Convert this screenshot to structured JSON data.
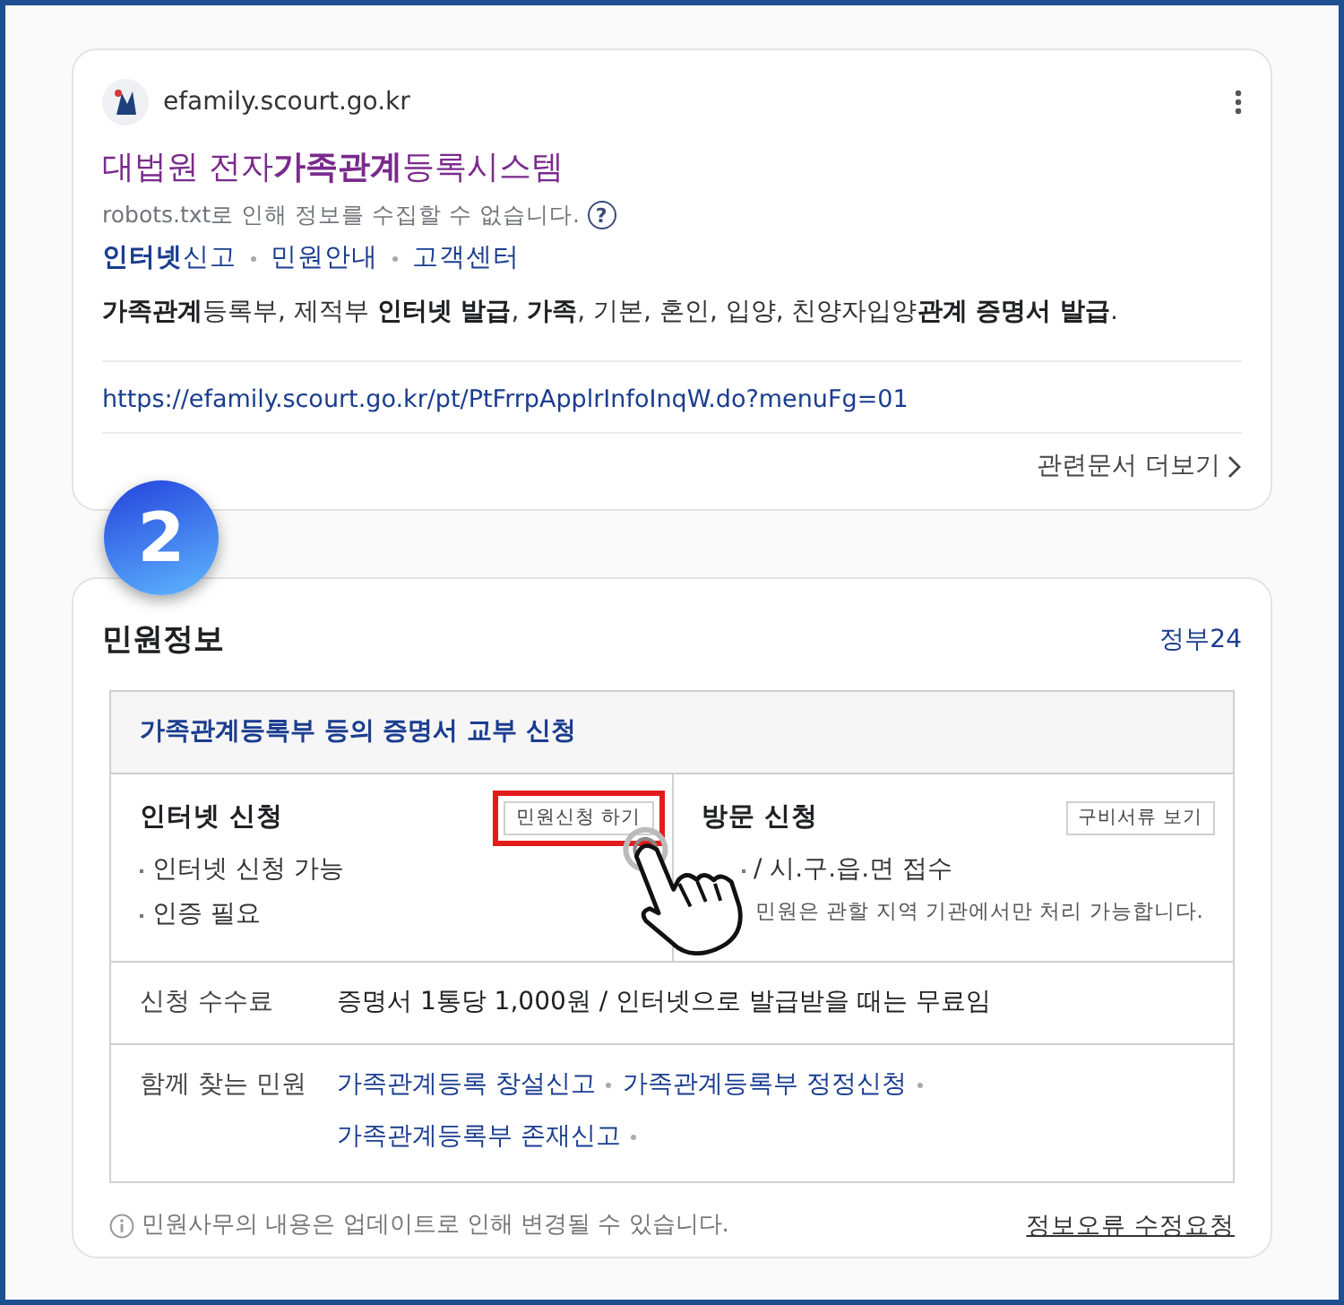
{
  "search_result": {
    "site": "efamily.scourt.go.kr",
    "title": "대법원 전자**가족관계**등록시스템",
    "robots_note": "robots.txt로 인해 정보를 수집할 수 없습니다.",
    "help_mark": "?",
    "sitelinks": [
      "**인터넷**신고",
      "민원안내",
      "고객센터"
    ],
    "snippet": "**가족관계**등록부, 제적부 **인터넷 발급**, **가족**, 기본, 혼인, 입양, 친양자입양**관계 증명서 발급**.",
    "url": "https://efamily.scourt.go.kr/pt/PtFrrpApplrInfoInqW.do?menuFg=01",
    "more_link": "관련문서 더보기"
  },
  "step_badge": "2",
  "civil_info": {
    "title": "민원정보",
    "source": "정부24",
    "service_title": "가족관계등록부 등의 증명서 교부 신청",
    "methods": [
      {
        "title": "인터넷 신청",
        "button": "민원신청 하기",
        "highlighted": true,
        "lines": [
          {
            "kind": "bullet",
            "text": "인터넷 신청 가능"
          },
          {
            "kind": "bullet",
            "text": "인증 필요"
          }
        ]
      },
      {
        "title": "방문 신청",
        "button": "구비서류 보기",
        "highlighted": false,
        "lines": [
          {
            "kind": "bullet",
            "text": "/ 시.구.읍.면 접수"
          },
          {
            "kind": "note",
            "text": "민원은 관할 지역 기관에서만 처리 가능합니다."
          }
        ]
      }
    ],
    "fee_label": "신청 수수료",
    "fee_value": "증명서 1통당 1,000원 / 인터넷으로 발급받을 때는 무료임",
    "related_label": "함께 찾는 민원",
    "related_links": [
      "가족관계등록 창설신고",
      "가족관계등록부 정정신청",
      "가족관계등록부 존재신고"
    ],
    "footer_note": "민원사무의 내용은 업데이트로 인해 변경될 수 있습니다.",
    "report_link": "정보오류 수정요청"
  }
}
